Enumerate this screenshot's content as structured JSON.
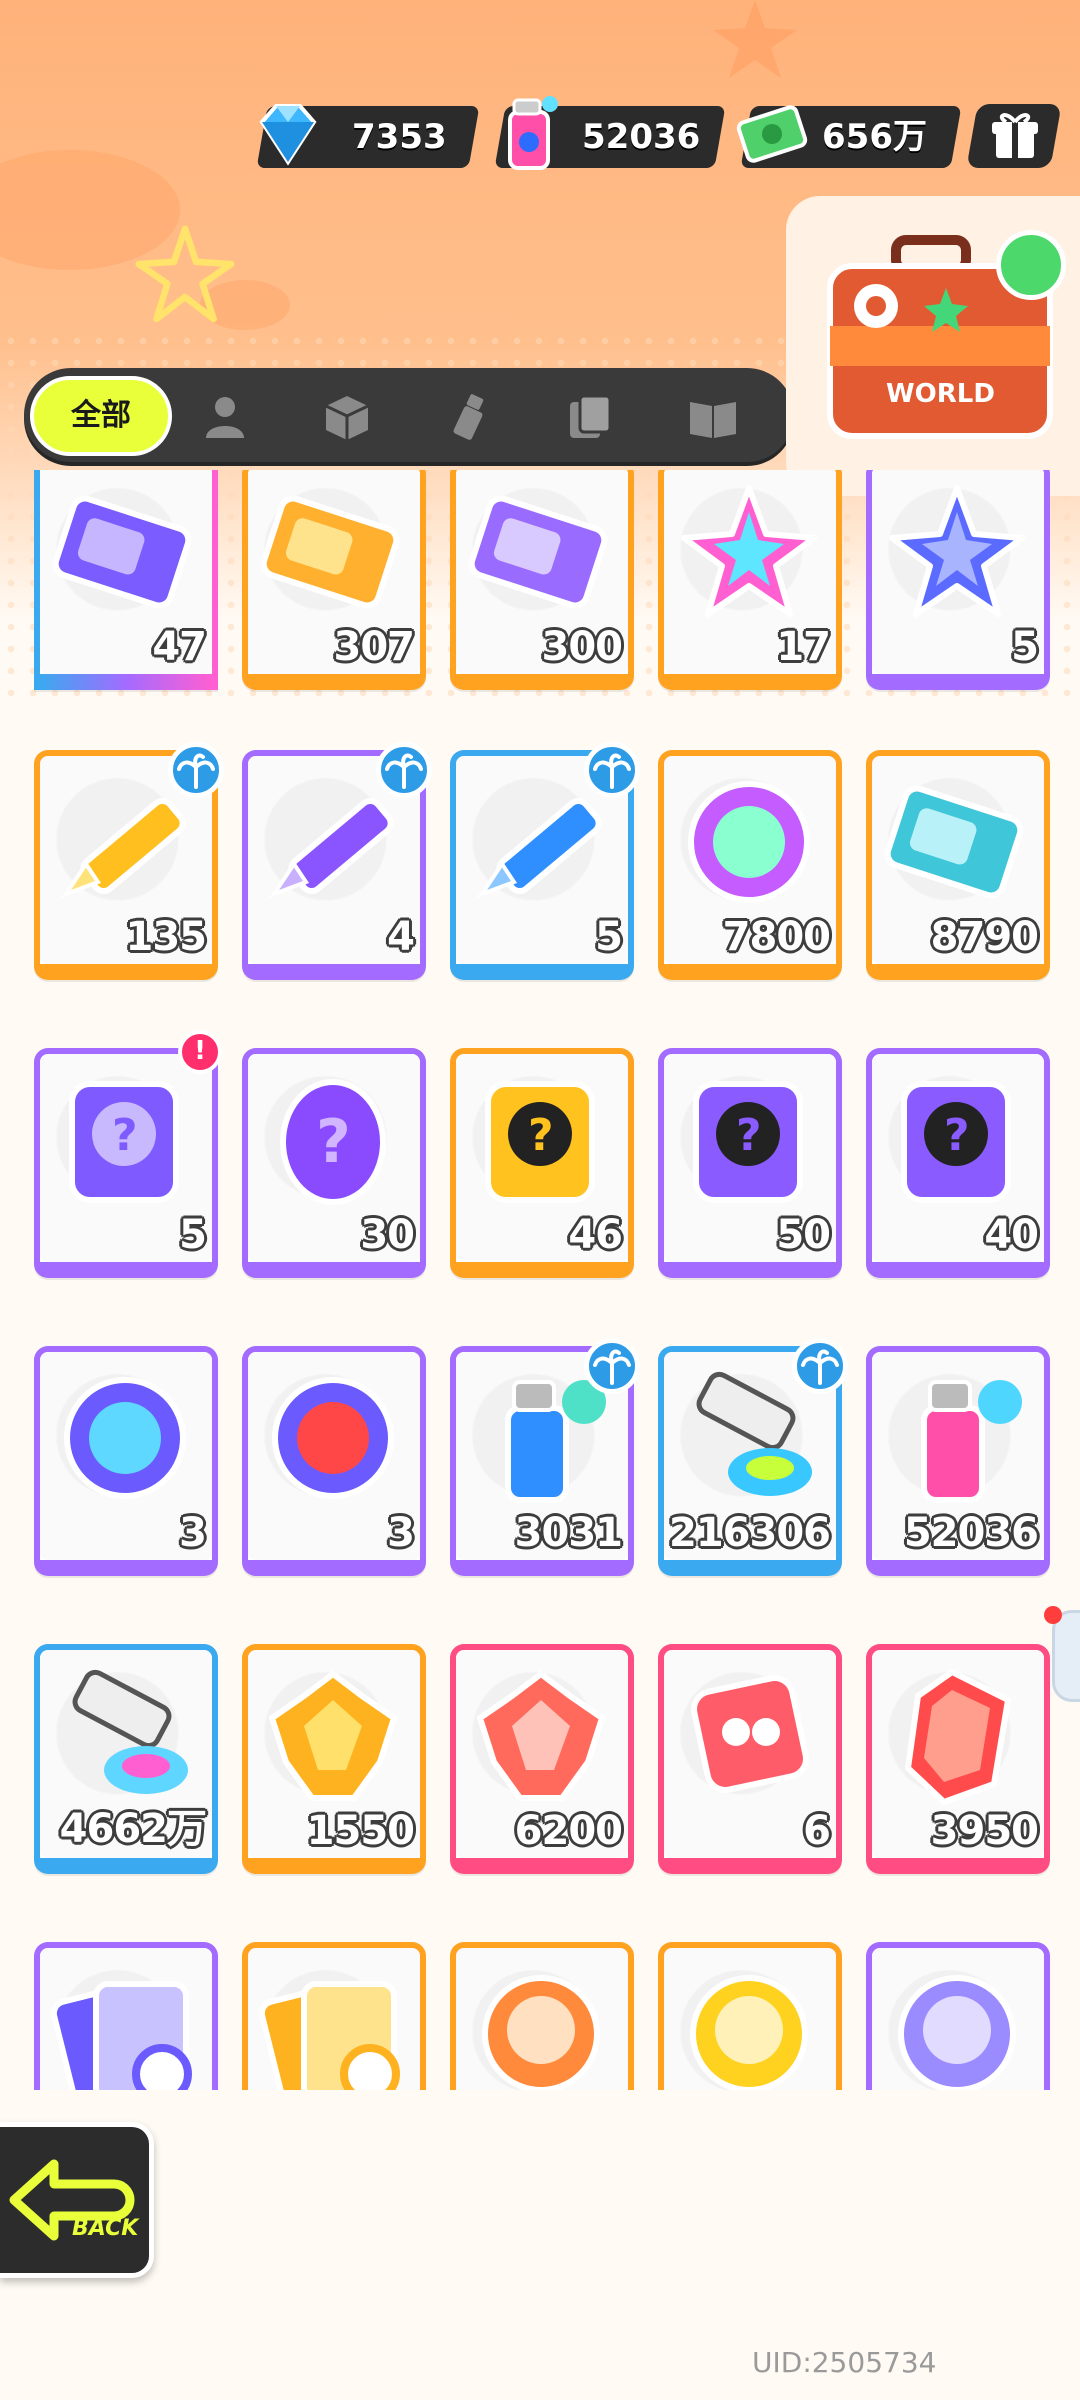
{
  "currencies": [
    {
      "name": "diamond",
      "icon": "diamond-icon",
      "value": "7353"
    },
    {
      "name": "spray",
      "icon": "spray-can-icon",
      "value": "52036"
    },
    {
      "name": "cash",
      "icon": "cash-icon",
      "value": "656万"
    }
  ],
  "gift_icon": "gift-box-icon",
  "tabs": {
    "all_label": "全部",
    "icons": [
      "person-icon",
      "box-icon",
      "spray-tag-icon",
      "card-stack-icon",
      "book-icon"
    ]
  },
  "world_icon": "world-suitcase-icon",
  "items": [
    {
      "icon": "ticket-purple-icon",
      "count": "47",
      "frame": "multi"
    },
    {
      "icon": "ticket-gold-icon",
      "count": "307",
      "frame": "orange"
    },
    {
      "icon": "ticket-violet-icon",
      "count": "300",
      "frame": "orange"
    },
    {
      "icon": "rainbow-star-icon",
      "count": "17",
      "frame": "orange"
    },
    {
      "icon": "blue-star-icon",
      "count": "5",
      "frame": "purple"
    },
    {
      "icon": "yellow-crayon-icon",
      "count": "135",
      "frame": "orange",
      "palm": true
    },
    {
      "icon": "purple-crayon-icon",
      "count": "4",
      "frame": "purple",
      "palm": true
    },
    {
      "icon": "blue-crayon-icon",
      "count": "5",
      "frame": "blue",
      "palm": true
    },
    {
      "icon": "cool-badge-icon",
      "count": "7800",
      "frame": "orange"
    },
    {
      "icon": "season-ticket-icon",
      "count": "8790",
      "frame": "orange"
    },
    {
      "icon": "travel-card-icon",
      "count": "5",
      "frame": "purple",
      "alert": true
    },
    {
      "icon": "mystery-egg-icon",
      "count": "30",
      "frame": "purple"
    },
    {
      "icon": "deity-mystery-gold-icon",
      "count": "46",
      "frame": "orange"
    },
    {
      "icon": "deity-mystery-purple-icon",
      "count": "50",
      "frame": "purple"
    },
    {
      "icon": "travel-card-mystery-icon",
      "count": "40",
      "frame": "purple"
    },
    {
      "icon": "blue-fish-orb-icon",
      "count": "3",
      "frame": "purple"
    },
    {
      "icon": "red-fish-orb-icon",
      "count": "3",
      "frame": "purple"
    },
    {
      "icon": "blue-spray-can-icon",
      "count": "3031",
      "frame": "purple",
      "palm": true
    },
    {
      "icon": "paint-tube-blue-icon",
      "count": "216306",
      "frame": "blue",
      "palm": true
    },
    {
      "icon": "pink-spray-can-icon",
      "count": "52036",
      "frame": "purple"
    },
    {
      "icon": "paint-tube-rainbow-icon",
      "count": "4662万",
      "frame": "blue"
    },
    {
      "icon": "gold-crystal-icon",
      "count": "1550",
      "frame": "orange"
    },
    {
      "icon": "red-crystal-icon",
      "count": "6200",
      "frame": "pink"
    },
    {
      "icon": "red-dice-icon",
      "count": "6",
      "frame": "pink"
    },
    {
      "icon": "red-gem-icon",
      "count": "3950",
      "frame": "pink"
    },
    {
      "icon": "purple-card-pack-icon",
      "count": "",
      "frame": "purple"
    },
    {
      "icon": "gold-card-pack-icon",
      "count": "",
      "frame": "orange"
    },
    {
      "icon": "deity-avatar-orange-icon",
      "count": "",
      "frame": "orange"
    },
    {
      "icon": "deity-avatar-yellow-icon",
      "count": "",
      "frame": "orange"
    },
    {
      "icon": "deity-avatar-purple-icon",
      "count": "",
      "frame": "purple"
    }
  ],
  "back_label": "BACK",
  "uid": "UID:2505734"
}
